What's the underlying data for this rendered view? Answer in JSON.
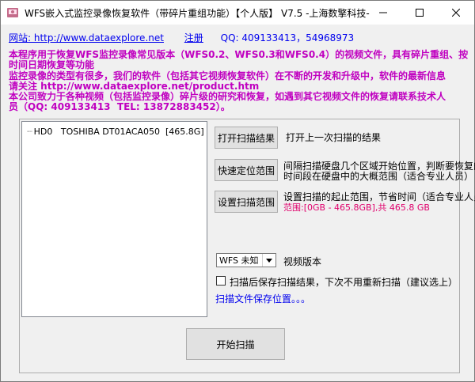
{
  "window": {
    "title": "WFS嵌入式监控录像恢复软件（带碎片重组功能）【个人版】 V7.5  -上海数擎科技-",
    "icon": "app-icon"
  },
  "links": {
    "website_label": "网站",
    "website_url": ": http://www.dataexplore.net",
    "register": "注册",
    "qq": "QQ:  409133413，54968973"
  },
  "notice_lines": [
    "本程序用于恢复WFS监控录像常见版本（WFS0.2、WFS0.3和WFS0.4）的视频文件，具有碎片重组、按",
    "时间日期恢复等功能",
    "监控录像的类型有很多，我们的软件（包括其它视频恢复软件）在不断的开发和升级中，软件的最新信息",
    "请关注 http://www.dataexplore.net/product.htm",
    "本公司致力于各种视频（包括监控录像）碎片级的研究和恢复，如遇到其它视频文件的恢复请联系技术人",
    "员（QQ: 409133413  TEL: 13872883452）。"
  ],
  "tree": {
    "node_label": "HD0   TOSHIBA DT01ACA050  [465.8G]"
  },
  "buttons": {
    "open_scan": "打开扫描结果",
    "quick_locate": "快速定位范围",
    "set_range": "设置扫描范围",
    "start_scan": "开始扫描"
  },
  "descriptions": {
    "open_scan": "打开上一次扫描的结果",
    "quick_locate_line1": "间隔扫描硬盘几个区域开始位置，判断要恢复的",
    "quick_locate_line2": "时间段在硬盘中的大概范围（适合专业人员）",
    "set_range_line1": "设置扫描的起止范围，节省时间（适合专业人员）",
    "range_value": "范围:[0GB - 465.8GB],共 465.8 GB"
  },
  "version_select": {
    "value": "WFS 未知",
    "label": "视频版本"
  },
  "save_option": {
    "label": "扫描后保存扫描结果，下次不用重新扫描（建议选上）",
    "checked": false,
    "location_link": "扫描文件保存位置。。。"
  },
  "colors": {
    "notice": "#c000c0",
    "link": "#0000ee",
    "range_value": "#e0006c"
  }
}
